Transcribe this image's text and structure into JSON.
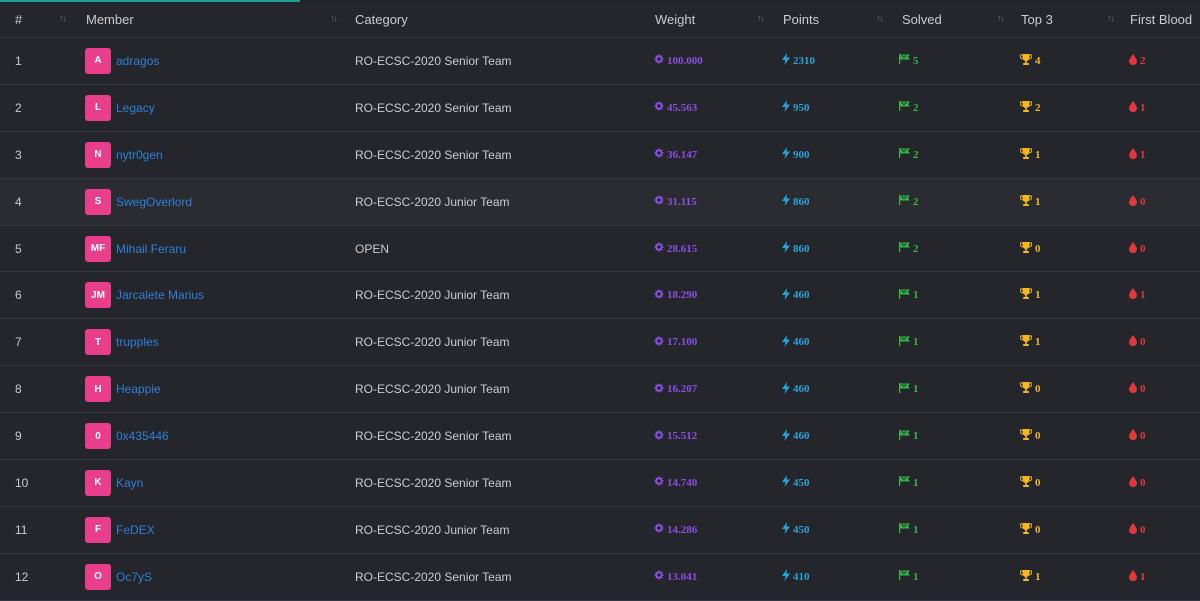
{
  "headers": {
    "rank": "#",
    "member": "Member",
    "category": "Category",
    "weight": "Weight",
    "points": "Points",
    "solved": "Solved",
    "top3": "Top 3",
    "first_blood": "First Blood"
  },
  "colors": {
    "avatar": "#e83e8c",
    "member_link": "#2f7fd8",
    "weight": "#8a4fe0",
    "points": "#2aa3d6",
    "solved": "#38b54a",
    "top3": "#f3b724",
    "first_blood": "#e0393b"
  },
  "icons": {
    "weight": "gear-badge-icon",
    "points": "lightning-bolt-icon",
    "solved": "flag-checkered-icon",
    "top3": "trophy-icon",
    "first_blood": "blood-drop-icon"
  },
  "rows": [
    {
      "rank": "1",
      "initials": "A",
      "name": "adragos",
      "category": "RO-ECSC-2020 Senior Team",
      "weight": "100.000",
      "points": "2310",
      "solved": "5",
      "top3": "4",
      "first_blood": "2"
    },
    {
      "rank": "2",
      "initials": "L",
      "name": "Legacy",
      "category": "RO-ECSC-2020 Senior Team",
      "weight": "45.563",
      "points": "950",
      "solved": "2",
      "top3": "2",
      "first_blood": "1"
    },
    {
      "rank": "3",
      "initials": "N",
      "name": "nytr0gen",
      "category": "RO-ECSC-2020 Senior Team",
      "weight": "36.147",
      "points": "900",
      "solved": "2",
      "top3": "1",
      "first_blood": "1"
    },
    {
      "rank": "4",
      "initials": "S",
      "name": "SwegOverlord",
      "category": "RO-ECSC-2020 Junior Team",
      "weight": "31.115",
      "points": "860",
      "solved": "2",
      "top3": "1",
      "first_blood": "0"
    },
    {
      "rank": "5",
      "initials": "MF",
      "name": "Mihail Feraru",
      "category": "OPEN",
      "weight": "28.615",
      "points": "860",
      "solved": "2",
      "top3": "0",
      "first_blood": "0"
    },
    {
      "rank": "6",
      "initials": "JM",
      "name": "Jarcalete Marius",
      "category": "RO-ECSC-2020 Junior Team",
      "weight": "18.290",
      "points": "460",
      "solved": "1",
      "top3": "1",
      "first_blood": "1"
    },
    {
      "rank": "7",
      "initials": "T",
      "name": "trupples",
      "category": "RO-ECSC-2020 Junior Team",
      "weight": "17.100",
      "points": "460",
      "solved": "1",
      "top3": "1",
      "first_blood": "0"
    },
    {
      "rank": "8",
      "initials": "H",
      "name": "Heappie",
      "category": "RO-ECSC-2020 Junior Team",
      "weight": "16.207",
      "points": "460",
      "solved": "1",
      "top3": "0",
      "first_blood": "0"
    },
    {
      "rank": "9",
      "initials": "0",
      "name": "0x435446",
      "category": "RO-ECSC-2020 Senior Team",
      "weight": "15.512",
      "points": "460",
      "solved": "1",
      "top3": "0",
      "first_blood": "0"
    },
    {
      "rank": "10",
      "initials": "K",
      "name": "Kayn",
      "category": "RO-ECSC-2020 Senior Team",
      "weight": "14.740",
      "points": "450",
      "solved": "1",
      "top3": "0",
      "first_blood": "0"
    },
    {
      "rank": "11",
      "initials": "F",
      "name": "FeDEX",
      "category": "RO-ECSC-2020 Junior Team",
      "weight": "14.286",
      "points": "450",
      "solved": "1",
      "top3": "0",
      "first_blood": "0"
    },
    {
      "rank": "12",
      "initials": "O",
      "name": "Oc7yS",
      "category": "RO-ECSC-2020 Senior Team",
      "weight": "13.041",
      "points": "410",
      "solved": "1",
      "top3": "1",
      "first_blood": "1"
    }
  ]
}
